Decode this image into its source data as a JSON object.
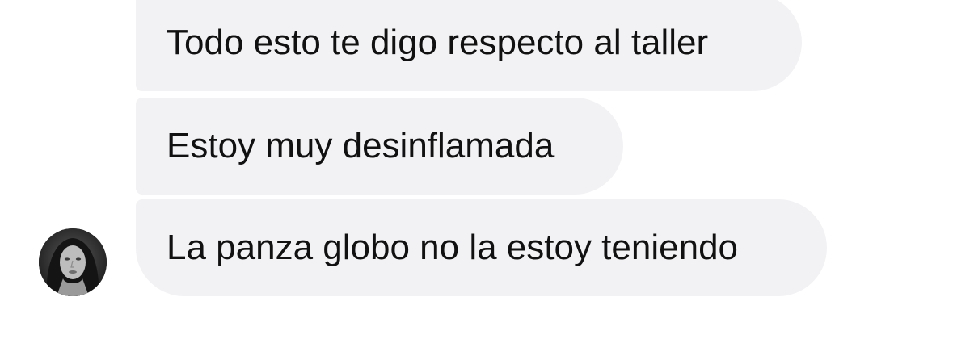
{
  "conversation": {
    "messages": [
      {
        "text": "Todo esto te digo respecto al taller"
      },
      {
        "text": "Estoy muy desinflamada"
      },
      {
        "text": "La panza globo no la estoy teniendo"
      }
    ]
  },
  "colors": {
    "bubble_background": "#f2f2f5",
    "text": "#111111",
    "background": "#ffffff"
  }
}
